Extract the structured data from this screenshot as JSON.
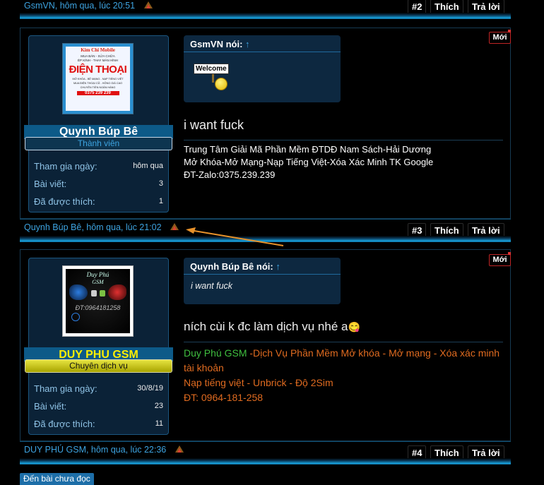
{
  "post2": {
    "author": "GsmVN",
    "time": ", hôm qua, lúc 20:51",
    "number": "#2",
    "like_label": "Thích",
    "reply_label": "Trả lời"
  },
  "post3": {
    "new_badge": "Mới",
    "avatar": {
      "top": "Kim Chi Mobile",
      "line1": "MUA BÁN - SỬA CHỮA",
      "line2": "ÉP KÍNH - THAY MÀN HÌNH",
      "big": "ĐIỆN THOẠI",
      "l3": "MỞ KHÓA - BẺ MẠNG - NẠP TIẾNG VIỆT",
      "l4": "MUA ĐIỆN THOẠI CŨ - HỎNG GIÁ CAO",
      "l5": "CHUYÊN TIỀN NGÂN HÀNG",
      "phone": "0375 239 239",
      "side": "Kim Chi Mobile"
    },
    "username": "Quynh Búp Bê",
    "user_title": "Thành viên",
    "stats": [
      {
        "label": "Tham gia ngày:",
        "value": "hôm qua"
      },
      {
        "label": "Bài viết:",
        "value": "3"
      },
      {
        "label": "Đã được thích:",
        "value": "1"
      }
    ],
    "quote_author": "GsmVN nói:",
    "quote_arrow": "↑",
    "welcome_sign": "Welcome",
    "message": "i want fuck",
    "signature": [
      "Trung Tâm Giải Mã Phần Mềm ĐTDĐ Nam Sách-Hải Dương",
      "Mở Khóa-Mở Mạng-Nạp Tiếng Việt-Xóa Xác Minh TK Google",
      "ĐT-Zalo:0375.239.239"
    ],
    "footer": {
      "author": "Quynh Búp Bê",
      "time": ", hôm qua, lúc 21:02",
      "number": "#3",
      "like_label": "Thích",
      "reply_label": "Trả lời"
    }
  },
  "post4": {
    "new_badge": "Mới",
    "avatar": {
      "line1": "Duy Phú",
      "line2": "GSM",
      "phone": "ĐT:0964181258"
    },
    "username": "DUY PHU GSM",
    "user_title": "Chuyên dịch vụ",
    "stats": [
      {
        "label": "Tham gia ngày:",
        "value": "30/8/19"
      },
      {
        "label": "Bài viết:",
        "value": "23"
      },
      {
        "label": "Đã được thích:",
        "value": "11"
      }
    ],
    "quote_author": "Quynh Búp Bê nói:",
    "quote_arrow": "↑",
    "quote_text": "i want fuck",
    "message": "ních cùi k đc làm dịch vụ nhé a",
    "emoji": "😋",
    "signature_name": "Duy Phú GSM",
    "signature_line1": " -Dịch Vụ Phần Mềm Mở khóa - Mở mạng - Xóa xác minh tài khoản",
    "signature_line2": "Nạp tiếng việt - Unbrick - Độ 2Sim",
    "signature_line3": "ĐT: 0964-181-258",
    "footer": {
      "author": "DUY PHÚ GSM",
      "time": ", hôm qua, lúc 22:36",
      "number": "#4",
      "like_label": "Thích",
      "reply_label": "Trả lời"
    }
  },
  "unread_button": "Đến bài chưa đọc",
  "colors": {
    "accent": "#3da3e0",
    "rank_yellow": "#c7c400",
    "rank_blue": "#0d5a88",
    "new_badge": "#c02525",
    "signature_green": "#3fbf3f",
    "signature_orange": "#e06b20",
    "annotation_arrow": "#e8922a"
  },
  "icons": [
    "report-icon",
    "quote-arrow-icon",
    "smiley-icon"
  ]
}
